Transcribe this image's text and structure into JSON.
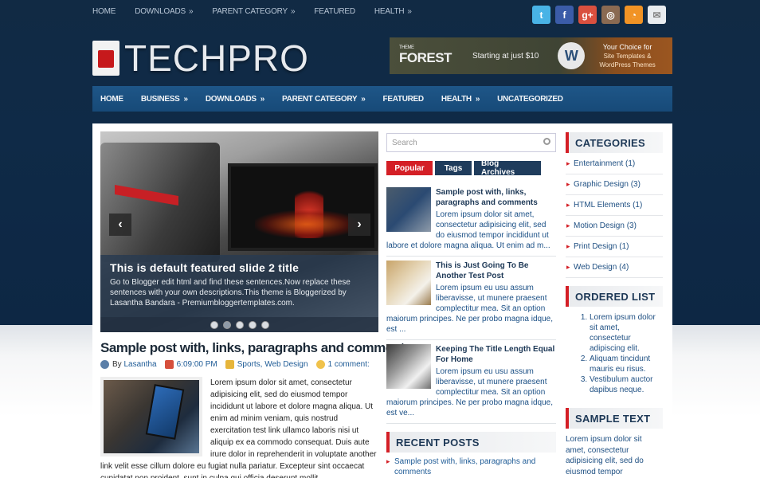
{
  "topnav": [
    {
      "label": "HOME",
      "arrow": ""
    },
    {
      "label": "DOWNLOADS",
      "arrow": "»"
    },
    {
      "label": "PARENT CATEGORY",
      "arrow": "»"
    },
    {
      "label": "FEATURED",
      "arrow": ""
    },
    {
      "label": "HEALTH",
      "arrow": "»"
    }
  ],
  "social": [
    "twitter-icon",
    "facebook-icon",
    "google-plus-icon",
    "instagram-icon",
    "rss-icon",
    "email-icon"
  ],
  "logo": {
    "text": "TECHPRO"
  },
  "banner": {
    "brand": "FOREST",
    "brand_small": "THEME",
    "offer": "Starting at just $10",
    "wp": "W",
    "choice_title": "Your Choice for",
    "choice_line1": "Site Templates &",
    "choice_line2": "WordPress Themes"
  },
  "mainnav": [
    {
      "label": "HOME",
      "arrow": ""
    },
    {
      "label": "BUSINESS",
      "arrow": "»"
    },
    {
      "label": "DOWNLOADS",
      "arrow": "»"
    },
    {
      "label": "PARENT CATEGORY",
      "arrow": "»"
    },
    {
      "label": "FEATURED",
      "arrow": ""
    },
    {
      "label": "HEALTH",
      "arrow": "»"
    },
    {
      "label": "UNCATEGORIZED",
      "arrow": ""
    }
  ],
  "slider": {
    "prev": "‹",
    "next": "›",
    "title": "This is default featured slide 2 title",
    "description": "Go to Blogger edit html and find these sentences.Now replace these sentences with your own descriptions.This theme is Bloggerized by Lasantha Bandara - Premiumbloggertemplates.com.",
    "dot_count": 5,
    "active_dot": 1
  },
  "post": {
    "title": "Sample post with, links, paragraphs and comments",
    "author": "Lasantha",
    "time": "6:09:00 PM",
    "categories": "Sports, Web Design",
    "comments": "1 comment:",
    "by": "By",
    "body": "Lorem ipsum dolor sit amet, consectetur adipisicing elit, sed do eiusmod tempor incididunt ut labore et dolore magna aliqua. Ut enim ad minim veniam, quis nostrud exercitation test link ullamco laboris nisi ut aliquip ex ea commodo consequat. Duis aute irure dolor in reprehenderit in voluptate another link velit esse cillum dolore eu fugiat nulla pariatur. Excepteur sint occaecat cupidatat non proident, sunt in culpa qui officia deserunt mollit"
  },
  "search": {
    "placeholder": "Search"
  },
  "tabs": [
    "Popular",
    "Tags",
    "Blog Archives"
  ],
  "popular": [
    {
      "title": "Sample post with, links, paragraphs and comments",
      "excerpt": "Lorem ipsum dolor sit amet, consectetur adipisicing elit, sed do eiusmod tempor incididunt ut labore et dolore magna aliqua. Ut enim ad m..."
    },
    {
      "title": "This is Just Going To Be Another Test Post",
      "excerpt": "Lorem ipsum eu usu assum liberavisse, ut munere praesent complectitur mea. Sit an option maiorum principes. Ne per probo magna idque, est ..."
    },
    {
      "title": "Keeping The Title Length Equal For Home",
      "excerpt": "Lorem ipsum eu usu assum liberavisse, ut munere praesent complectitur mea. Sit an option maiorum principes. Ne per probo magna idque, est ve..."
    }
  ],
  "recent": {
    "heading": "RECENT POSTS",
    "items": [
      "Sample post with, links, paragraphs and comments"
    ]
  },
  "categories": {
    "heading": "CATEGORIES",
    "items": [
      "Entertainment (1)",
      "Graphic Design (3)",
      "HTML Elements (1)",
      "Motion Design (3)",
      "Print Design (1)",
      "Web Design (4)"
    ]
  },
  "ordered": {
    "heading": "ORDERED LIST",
    "items": [
      "Lorem ipsum dolor sit amet, consectetur adipiscing elit.",
      "Aliquam tincidunt mauris eu risus.",
      "Vestibulum auctor dapibus neque."
    ]
  },
  "sample": {
    "heading": "SAMPLE TEXT",
    "text": "Lorem ipsum dolor sit amet, consectetur adipisicing elit, sed do eiusmod tempor"
  },
  "colors": {
    "accent": "#d41f26",
    "navy": "#1f3c5c",
    "nav": "#1e5688"
  }
}
